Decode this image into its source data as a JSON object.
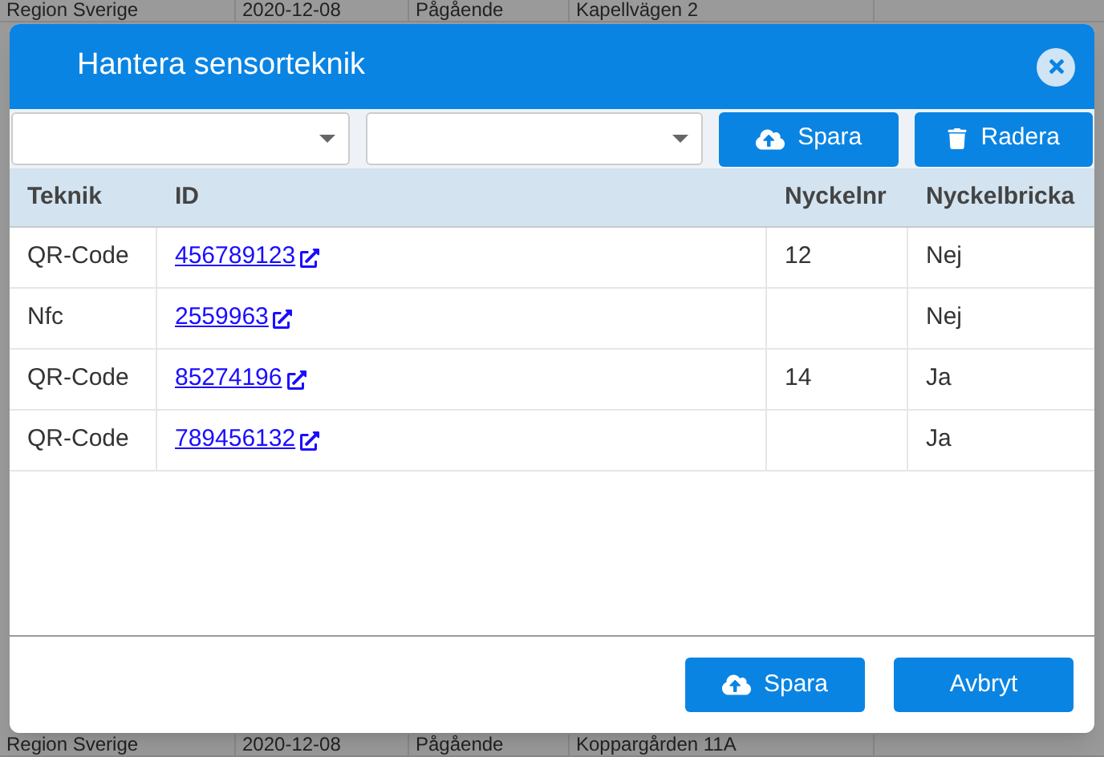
{
  "background_table": {
    "rows": [
      [
        "Region Sverige",
        "2020-12-08",
        "Pågående",
        "Kapellvägen 2"
      ],
      [
        "Region Sverige",
        "2020-12-08",
        "Pågående",
        "Koppargården 11A"
      ]
    ]
  },
  "dialog": {
    "title": "Hantera sensorteknik",
    "selects": [
      {
        "kind": "select"
      },
      {
        "kind": "select"
      }
    ],
    "toolbar_buttons": [
      {
        "kind": "save",
        "label": "Spara"
      },
      {
        "kind": "delete",
        "label": "Radera"
      }
    ],
    "table": {
      "columns": [
        "Teknik",
        "ID",
        "Nyckelnr",
        "Nyckelbricka"
      ],
      "rows": [
        {
          "teknik": "QR-Code",
          "id": "456789123",
          "nyckelnr": "12",
          "nyckelbricka": "Nej"
        },
        {
          "teknik": "Nfc",
          "id": "2559963",
          "nyckelnr": "",
          "nyckelbricka": "Nej"
        },
        {
          "teknik": "QR-Code",
          "id": "85274196",
          "nyckelnr": "14",
          "nyckelbricka": "Ja"
        },
        {
          "teknik": "QR-Code",
          "id": "789456132",
          "nyckelnr": "",
          "nyckelbricka": "Ja"
        }
      ]
    },
    "footer_buttons": [
      {
        "kind": "save",
        "label": "Spara"
      },
      {
        "kind": "cancel",
        "label": "Avbryt"
      }
    ]
  }
}
